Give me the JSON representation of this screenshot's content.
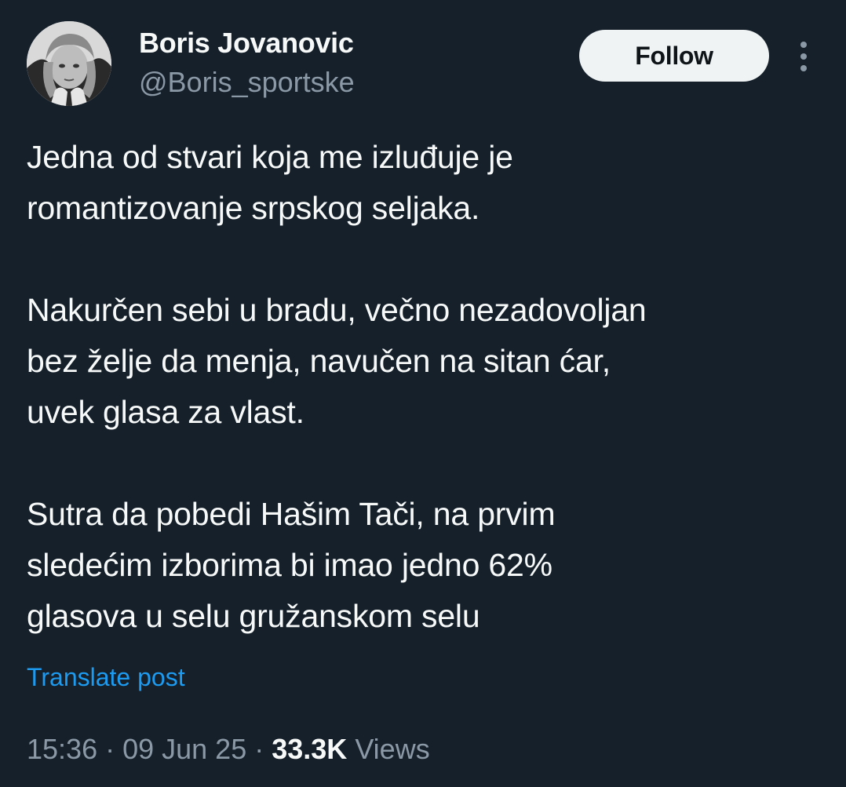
{
  "author": {
    "name": "Boris Jovanovic",
    "handle": "@Boris_sportske",
    "avatar_icon": "profile-photo"
  },
  "actions": {
    "follow_label": "Follow",
    "more_icon": "vertical-ellipsis-icon"
  },
  "post": {
    "paragraphs": [
      {
        "lines": [
          "Jedna od stvari koja me izluđuje je",
          "romantizovanje srpskog seljaka."
        ]
      },
      {
        "lines": [
          "Nakurčen sebi u bradu, večno nezadovoljan",
          "bez želje da menja, navučen na sitan ćar,",
          "uvek glasa za vlast."
        ]
      },
      {
        "lines": [
          "Sutra da pobedi Hašim Tači, na prvim",
          "sledećim izborima bi imao jedno 62%",
          "glasova u selu gružanskom selu"
        ]
      }
    ],
    "translate_label": "Translate post"
  },
  "meta": {
    "time": "15:36",
    "separator": " · ",
    "date": "09 Jun 25",
    "views_count": "33.3K",
    "views_label": " Views"
  },
  "colors": {
    "background": "#15202b",
    "text": "#f7f9f9",
    "secondary": "#8b98a5",
    "link": "#1d9bf0",
    "button_bg": "#eff3f4"
  }
}
